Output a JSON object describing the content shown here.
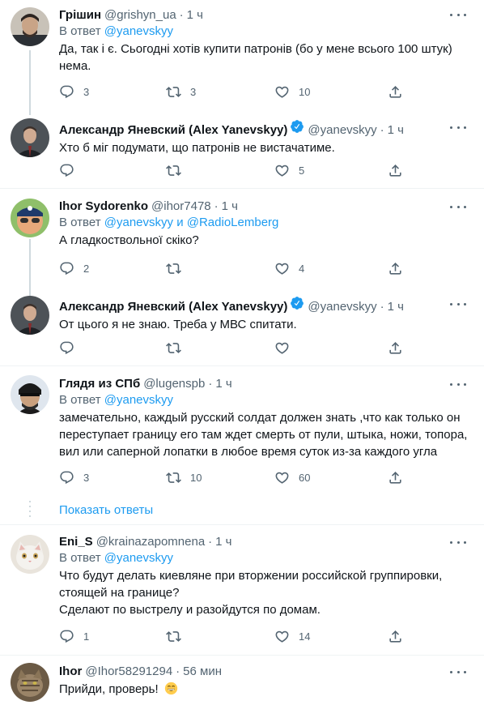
{
  "reply_prefix": "В ответ",
  "and_word": "и",
  "colors": {
    "accent": "#1d9bf0",
    "muted": "#536471",
    "text": "#0f1419",
    "border": "#eff3f4",
    "thread": "#cfd9de"
  },
  "icons": {
    "reply": "reply-icon",
    "retweet": "retweet-icon",
    "like": "heart-icon",
    "share": "share-icon",
    "more": "more-icon",
    "verified": "verified-badge-icon"
  },
  "tweets": [
    {
      "name": "Грішин",
      "handle": "@grishyn_ua",
      "time": "1 ч",
      "reply_to": "@yanevskyy",
      "text": "Да, так і є. Сьогодні хотів купити патронів (бо у мене всього 100 штук) нема.",
      "replies": "3",
      "retweets": "3",
      "likes": "10"
    },
    {
      "name": "Александр Яневский (Alex Yanevskyy)",
      "handle": "@yanevskyy",
      "time": "1 ч",
      "text": "Хто б міг подумати, що патронів не вистачатиме.",
      "replies": "",
      "retweets": "",
      "likes": "5"
    },
    {
      "name": "Ihor Sydorenko",
      "handle": "@ihor7478",
      "time": "1 ч",
      "reply_to": "@yanevskyy",
      "reply_to_2": "@RadioLemberg",
      "text": "А гладкоствольної скіко?",
      "replies": "2",
      "retweets": "",
      "likes": "4"
    },
    {
      "name": "Александр Яневский (Alex Yanevskyy)",
      "handle": "@yanevskyy",
      "time": "1 ч",
      "text": "От цього я не знаю. Треба у МВС спитати.",
      "replies": "",
      "retweets": "",
      "likes": ""
    },
    {
      "name": "Глядя из СПб",
      "handle": "@lugenspb",
      "time": "1 ч",
      "reply_to": "@yanevskyy",
      "text": "замечательно, каждый русский солдат должен знать ,что как только он переступает границу его там ждет смерть от пули, штыка, ножи, топора, вил или саперной лопатки в любое время суток из-за каждого угла",
      "replies": "3",
      "retweets": "10",
      "likes": "60"
    },
    {
      "name": "Eni_S",
      "handle": "@krainazapomnena",
      "time": "1 ч",
      "reply_to": "@yanevskyy",
      "text_lines": [
        "Что будут делать киевляне при вторжении российской группировки, стоящей на границе?",
        "Сделают по выстрелу и разойдутся по домам."
      ],
      "replies": "1",
      "retweets": "",
      "likes": "14"
    },
    {
      "name": "Ihor",
      "handle": "@Ihor58291294",
      "time": "56 мин",
      "text": "Прийди, проверь!"
    }
  ],
  "show_replies": "Показать ответы"
}
